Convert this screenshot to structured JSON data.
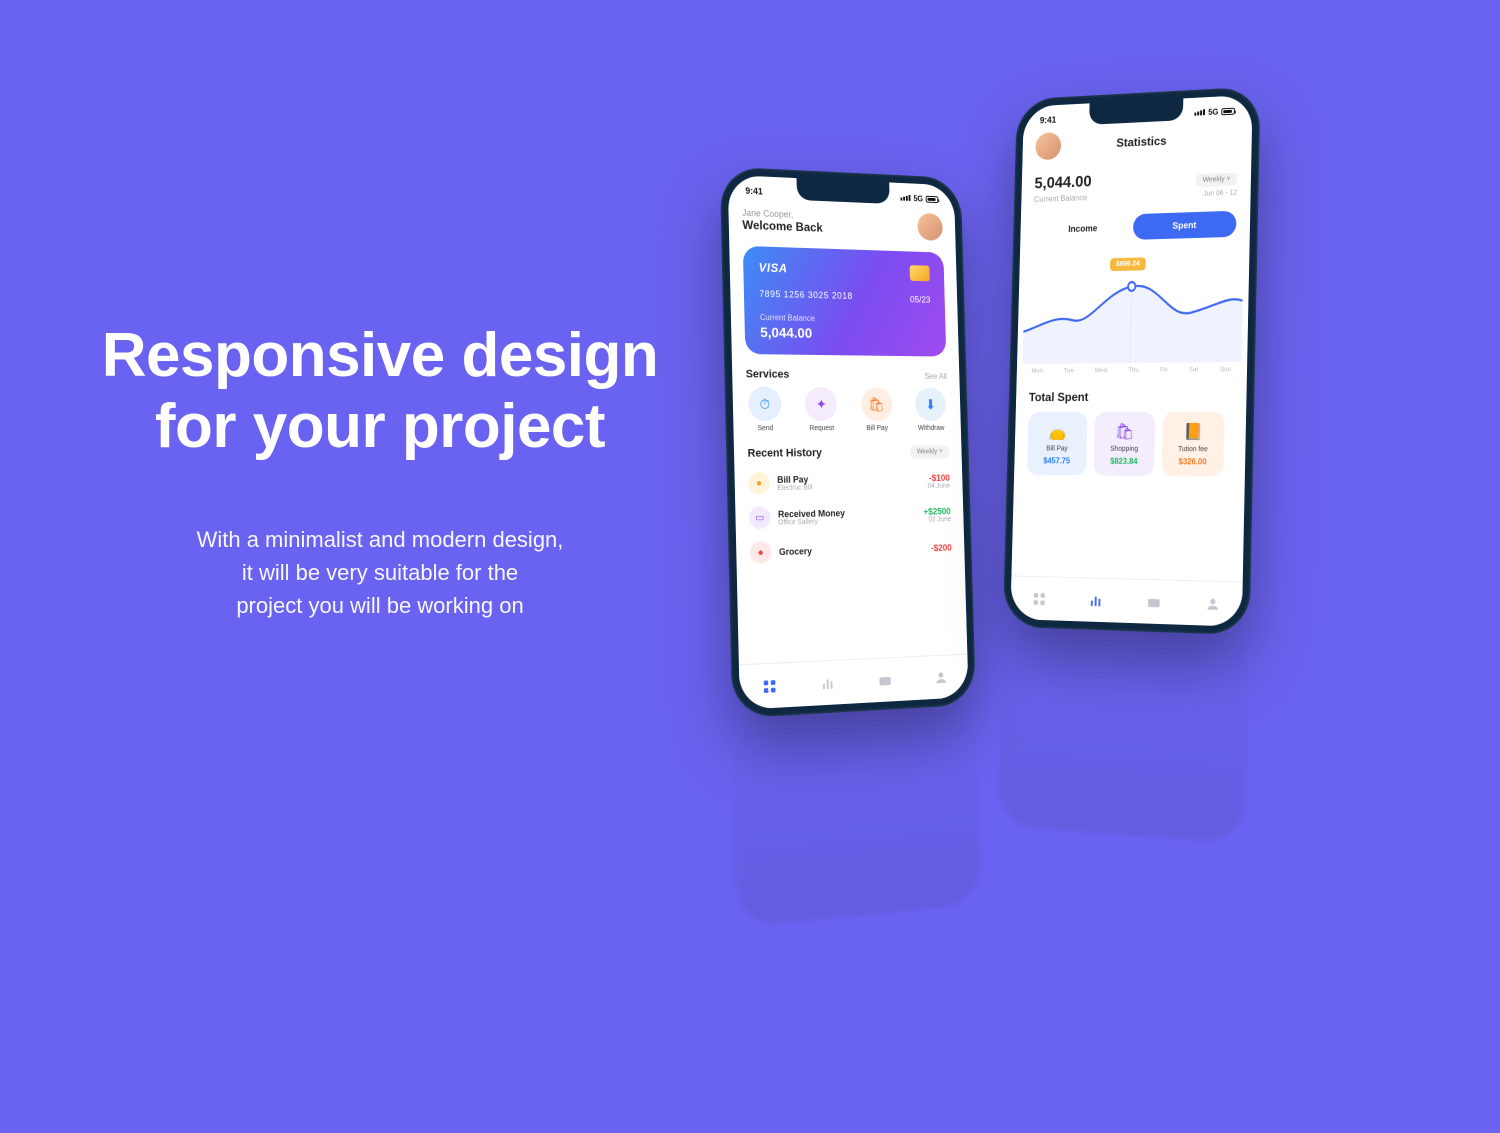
{
  "hero": {
    "title_line1": "Responsive design",
    "title_line2": "for your project",
    "body_line1": "With a minimalist and modern design,",
    "body_line2": "it will be very suitable for the",
    "body_line3": "project you will be working on"
  },
  "status": {
    "time": "9:41",
    "net": "5G"
  },
  "phone_home": {
    "greeting_name": "Jane Cooper,",
    "greeting_welcome": "Welcome Back",
    "card": {
      "brand": "VISA",
      "number": "7895 1256 3025 2018",
      "expiry": "05/23",
      "balance_label": "Current Balance",
      "balance_value": "5,044.00"
    },
    "services_header": "Services",
    "see_all": "See All",
    "services": [
      {
        "label": "Send"
      },
      {
        "label": "Request"
      },
      {
        "label": "Bill Pay"
      },
      {
        "label": "Withdraw"
      }
    ],
    "history_header": "Recent History",
    "history_filter": "Weekly",
    "history": [
      {
        "title": "Bill Pay",
        "subtitle": "Electruc Bill",
        "amount": "-$100",
        "date": "04 June",
        "sign": "neg",
        "ic": "hic-y"
      },
      {
        "title": "Received Money",
        "subtitle": "Office Sallery",
        "amount": "+$2500",
        "date": "02 June",
        "sign": "pos",
        "ic": "hic-p"
      },
      {
        "title": "Grocery",
        "subtitle": "",
        "amount": "-$200",
        "date": "",
        "sign": "neg",
        "ic": "hic-r"
      }
    ]
  },
  "phone_stats": {
    "title": "Statistics",
    "balance_value": "5,044.00",
    "balance_label": "Current Balance",
    "period": "Weekly",
    "date_range": "Jun 06 - 12",
    "tab_income": "Income",
    "tab_spent": "Spent",
    "tooltip": "$896.24",
    "days": [
      "Mon",
      "Tue",
      "Wed",
      "Thu",
      "Fri",
      "Sat",
      "Sun"
    ],
    "total_spent_header": "Total Spent",
    "spent_cards": [
      {
        "label": "Bill Pay",
        "value": "$457.75"
      },
      {
        "label": "Shopping",
        "value": "$823.84"
      },
      {
        "label": "Tution fee",
        "value": "$326.00"
      }
    ]
  }
}
